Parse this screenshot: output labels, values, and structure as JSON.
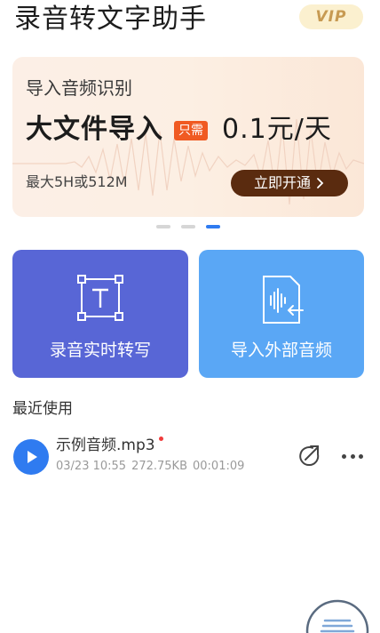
{
  "header": {
    "title": "录音转文字助手",
    "vip_label": "VIP"
  },
  "banner": {
    "subtitle": "导入音频识别",
    "headline": "大文件导入",
    "tag": "只需",
    "price": "0.1元/天",
    "limit": "最大5H或512M",
    "cta": "立即开通",
    "cta_icon": "chevron-right-icon",
    "page_count": 3,
    "active_page": 3
  },
  "actions": {
    "record": {
      "label": "录音实时转写",
      "icon": "text-frame-icon"
    },
    "import": {
      "label": "导入外部音频",
      "icon": "audio-import-icon"
    }
  },
  "recent": {
    "title": "最近使用",
    "items": [
      {
        "name": "示例音频.mp3",
        "date": "03/23 10:55",
        "size": "272.75KB",
        "duration": "00:01:09",
        "unread": true
      }
    ]
  },
  "colors": {
    "accent": "#2f7bf0",
    "record_card": "#5866d6",
    "import_card": "#5aa7f5",
    "cta_bg": "#5a2b0f",
    "tag_bg": "#f05a22",
    "vip_text": "#c79a52"
  }
}
